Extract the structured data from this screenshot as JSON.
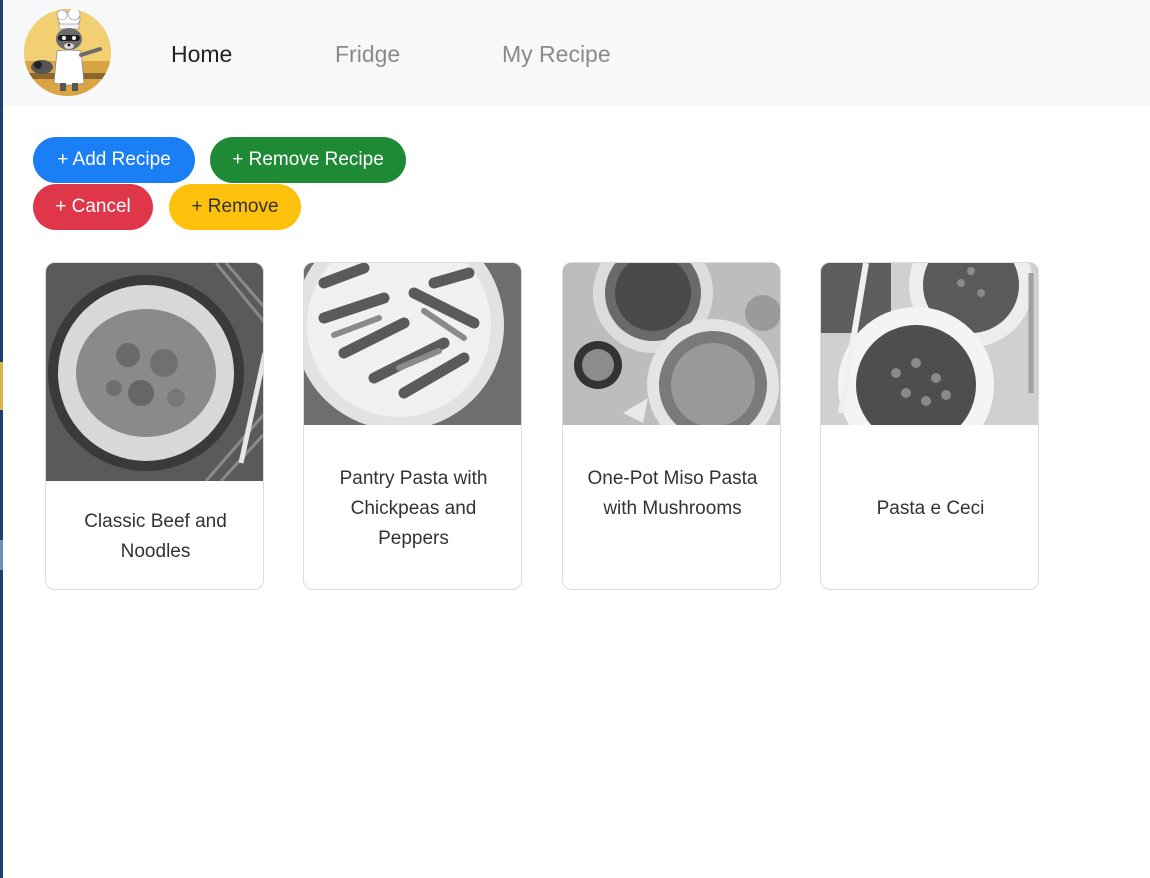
{
  "nav": {
    "logo_alt": "raccoon chef logo",
    "links": [
      {
        "label": "Home",
        "active": true
      },
      {
        "label": "Fridge",
        "active": false
      },
      {
        "label": "My Recipe",
        "active": false
      }
    ]
  },
  "actions": {
    "add_recipe": "+ Add Recipe",
    "remove_recipe": "+ Remove Recipe",
    "cancel": "+ Cancel",
    "remove": "+ Remove"
  },
  "colors": {
    "primary": "#1a7ff5",
    "success": "#1f8a35",
    "danger": "#e0364a",
    "warning": "#fec10c"
  },
  "recipes": [
    {
      "title": "Classic Beef and Noodles",
      "image": "plate-of-egg-noodles-with-beef-stew"
    },
    {
      "title": "Pantry Pasta with Chickpeas and Peppers",
      "image": "bowl-of-penne-pasta"
    },
    {
      "title": "One-Pot Miso Pasta with Mushrooms",
      "image": "bowls-of-spaghetti-with-mushrooms"
    },
    {
      "title": "Pasta e Ceci",
      "image": "bowls-of-ditalini-pasta-with-chickpeas"
    }
  ]
}
